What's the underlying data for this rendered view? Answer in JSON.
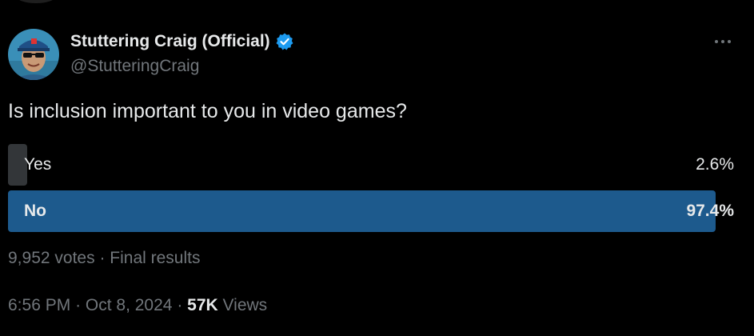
{
  "tweet": {
    "author": {
      "display_name": "Stuttering Craig (Official)",
      "handle": "@StutteringCraig",
      "verified": true,
      "avatar_icon": "user-avatar-photo"
    },
    "more_icon": "more-horizontal-icon",
    "text": "Is inclusion important to you in video games?",
    "poll": {
      "options": [
        {
          "label": "Yes",
          "percent_text": "2.6%",
          "percent": 2.6,
          "leading": false
        },
        {
          "label": "No",
          "percent_text": "97.4%",
          "percent": 97.4,
          "leading": true
        }
      ],
      "votes": "9,952 votes",
      "separator": "·",
      "status": "Final results"
    },
    "meta": {
      "time": "6:56 PM",
      "separator": "·",
      "date": "Oct 8, 2024",
      "views_count": "57K",
      "views_label": "Views"
    },
    "colors": {
      "background": "#000000",
      "text_primary": "#e7e9ea",
      "text_secondary": "#71767b",
      "poll_leading": "#1d5a8d",
      "poll_other": "#333639",
      "verified": "#1d9bf0"
    }
  }
}
